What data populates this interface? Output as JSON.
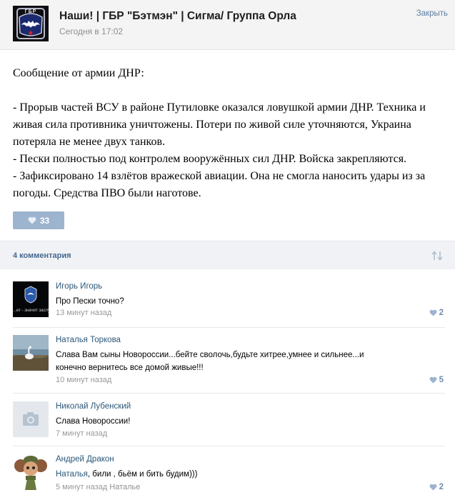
{
  "header": {
    "title": "Наши! | ГБР \"Бэтмэн\" | Сигма/ Группа Орла",
    "date": "Сегодня в 17:02",
    "close_label": "Закрыть",
    "avatar_text": "ГБР"
  },
  "post": {
    "paragraphs": [
      "Сообщение от армии ДНР:",
      "",
      "- Прорыв частей ВСУ в районе Путиловке оказался ловушкой армии ДНР. Техника и живая сила противника уничтожены. Потери по живой силе уточняются, Украина потеряла не менее двух танков.",
      "- Пески полностью под контролем вооружённых сил ДНР. Войска закрепляются.",
      "- Зафиксировано 14 взлётов вражеской авиации. Она не смогла наносить удары из за погоды. Средства ПВО были наготове."
    ],
    "likes": "33"
  },
  "comments_bar": {
    "label": "4 комментария"
  },
  "comments": [
    {
      "author": "Игорь Игорь",
      "text": "Про Пески точно?",
      "time": "13 минут назад",
      "likes": "2",
      "avatar_caption": "...ет - значит заслуж"
    },
    {
      "author": "Наталья Торкова",
      "text": "Слава Вам сыны Новороссии...бейте сволочь,будьте хитрее,умнее и сильнее...и конечно вернитесь все домой живые!!!",
      "time": "10 минут назад",
      "likes": "5"
    },
    {
      "author": "Николай Лубенский",
      "text": "Слава Новороссии!",
      "time": "7 минут назад",
      "likes": ""
    },
    {
      "author": "Андрей Дракон",
      "reply_name": "Наталья",
      "text": ", били , бьём и бить будим)))",
      "time": "5 минут назад",
      "reply_to": "Наталье",
      "likes": "2"
    }
  ],
  "colors": {
    "accent": "#45688e",
    "link": "#2b587a",
    "like_button": "#9db4cf",
    "meta_gray": "#999999"
  }
}
